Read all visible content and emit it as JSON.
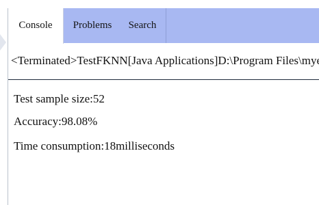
{
  "tabs": [
    {
      "label": "Console"
    },
    {
      "label": "Problems"
    },
    {
      "label": "Search"
    }
  ],
  "console": {
    "header": "<Terminated>TestFKNN[Java Applications]D:\\Program Files\\myeclipse\\",
    "lines": [
      {
        "text": "Test sample size:52"
      },
      {
        "text": "Accuracy:98.08%"
      },
      {
        "text": "Time consumption:18milliseconds"
      }
    ]
  },
  "colors": {
    "tab_bar_background": "#a8b8f2",
    "active_tab_background": "#ffffff",
    "separator": "#1e2a3a"
  }
}
